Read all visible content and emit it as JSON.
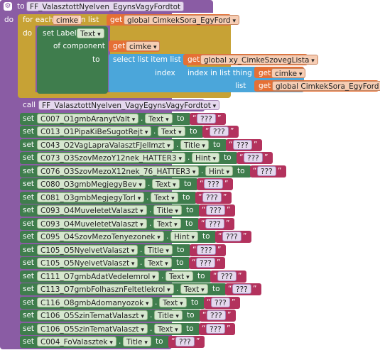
{
  "procedure": {
    "to_keyword": "to",
    "name": "FF_ValasztottNyelven_EgynsVagyFordtot",
    "do_keyword": "do"
  },
  "foreach": {
    "for_each": "for each",
    "var_name": "cimke",
    "in_list": "in list",
    "get": "get",
    "list_var": "global CimkekSora_EgyFord",
    "do_keyword": "do"
  },
  "setlabel": {
    "set_label": "set Label.",
    "property": "Text",
    "of_component": "of component",
    "get": "get",
    "component_var": "cimke",
    "to_keyword": "to"
  },
  "selectlist": {
    "label": "select list item  list",
    "get1": "get",
    "list_var": "global xy_CimkeSzovegLista",
    "index_label": "index",
    "index_in_list": "index in list  thing",
    "get2": "get",
    "thing_var": "cimke",
    "list_label": "list",
    "get3": "get",
    "list_var2": "global CimkekSora_EgyFord"
  },
  "call": {
    "call_keyword": "call",
    "name": "FF_ValasztottNyelven_VagyEgynsVagyFordtot"
  },
  "set_rows": [
    {
      "set": "set",
      "component": "C007_O1gmbAranytValt",
      "property": "Text",
      "to": "to",
      "value": "???"
    },
    {
      "set": "set",
      "component": "C013_O1PipaKiBeSugotRejt",
      "property": "Text",
      "to": "to",
      "value": "???"
    },
    {
      "set": "set",
      "component": "C043_O2VagLapraValasztFJellmzt",
      "property": "Title",
      "to": "to",
      "value": "???"
    },
    {
      "set": "set",
      "component": "C073_O3SzovMezoY12nek_HATTER3",
      "property": "Hint",
      "to": "to",
      "value": "???"
    },
    {
      "set": "set",
      "component": "C076_O3SzovMezoX12nek_76_HATTER3",
      "property": "Hint",
      "to": "to",
      "value": "???"
    },
    {
      "set": "set",
      "component": "C080_O3gmbMegjegyBev",
      "property": "Text",
      "to": "to",
      "value": "???"
    },
    {
      "set": "set",
      "component": "C081_O3gmbMegjegyTorl",
      "property": "Text",
      "to": "to",
      "value": "???"
    },
    {
      "set": "set",
      "component": "C093_O4MuveletetValaszt",
      "property": "Title",
      "to": "to",
      "value": "???"
    },
    {
      "set": "set",
      "component": "C093_O4MuveletetValaszt",
      "property": "Text",
      "to": "to",
      "value": "???"
    },
    {
      "set": "set",
      "component": "C095_O4SzovMezoTenyezonek",
      "property": "Hint",
      "to": "to",
      "value": "???"
    },
    {
      "set": "set",
      "component": "C105_O5NyelvetValaszt",
      "property": "Title",
      "to": "to",
      "value": "???"
    },
    {
      "set": "set",
      "component": "C105_O5NyelvetValaszt",
      "property": "Text",
      "to": "to",
      "value": "???"
    },
    {
      "set": "set",
      "component": "C111_O7gmbAdatVedelemrol",
      "property": "Text",
      "to": "to",
      "value": "???"
    },
    {
      "set": "set",
      "component": "C113_O7gmbFolhasznFeltetlekrol",
      "property": "Text",
      "to": "to",
      "value": "???"
    },
    {
      "set": "set",
      "component": "C116_O8gmbAdomanyozok",
      "property": "Text",
      "to": "to",
      "value": "???"
    },
    {
      "set": "set",
      "component": "C106_O5SzinTematValaszt",
      "property": "Title",
      "to": "to",
      "value": "???"
    },
    {
      "set": "set",
      "component": "C106_O5SzinTematValaszt",
      "property": "Text",
      "to": "to",
      "value": "???"
    },
    {
      "set": "set",
      "component": "C004_FoValasztek",
      "property": "Title",
      "to": "to",
      "value": "???"
    }
  ],
  "icons": {
    "gear": "gear-icon"
  },
  "colors": {
    "procedure": "#8a5ca4",
    "control": "#c7a235",
    "component": "#3f7d4d",
    "variable": "#e57035",
    "list": "#4ba6da",
    "text": "#b3325d"
  }
}
